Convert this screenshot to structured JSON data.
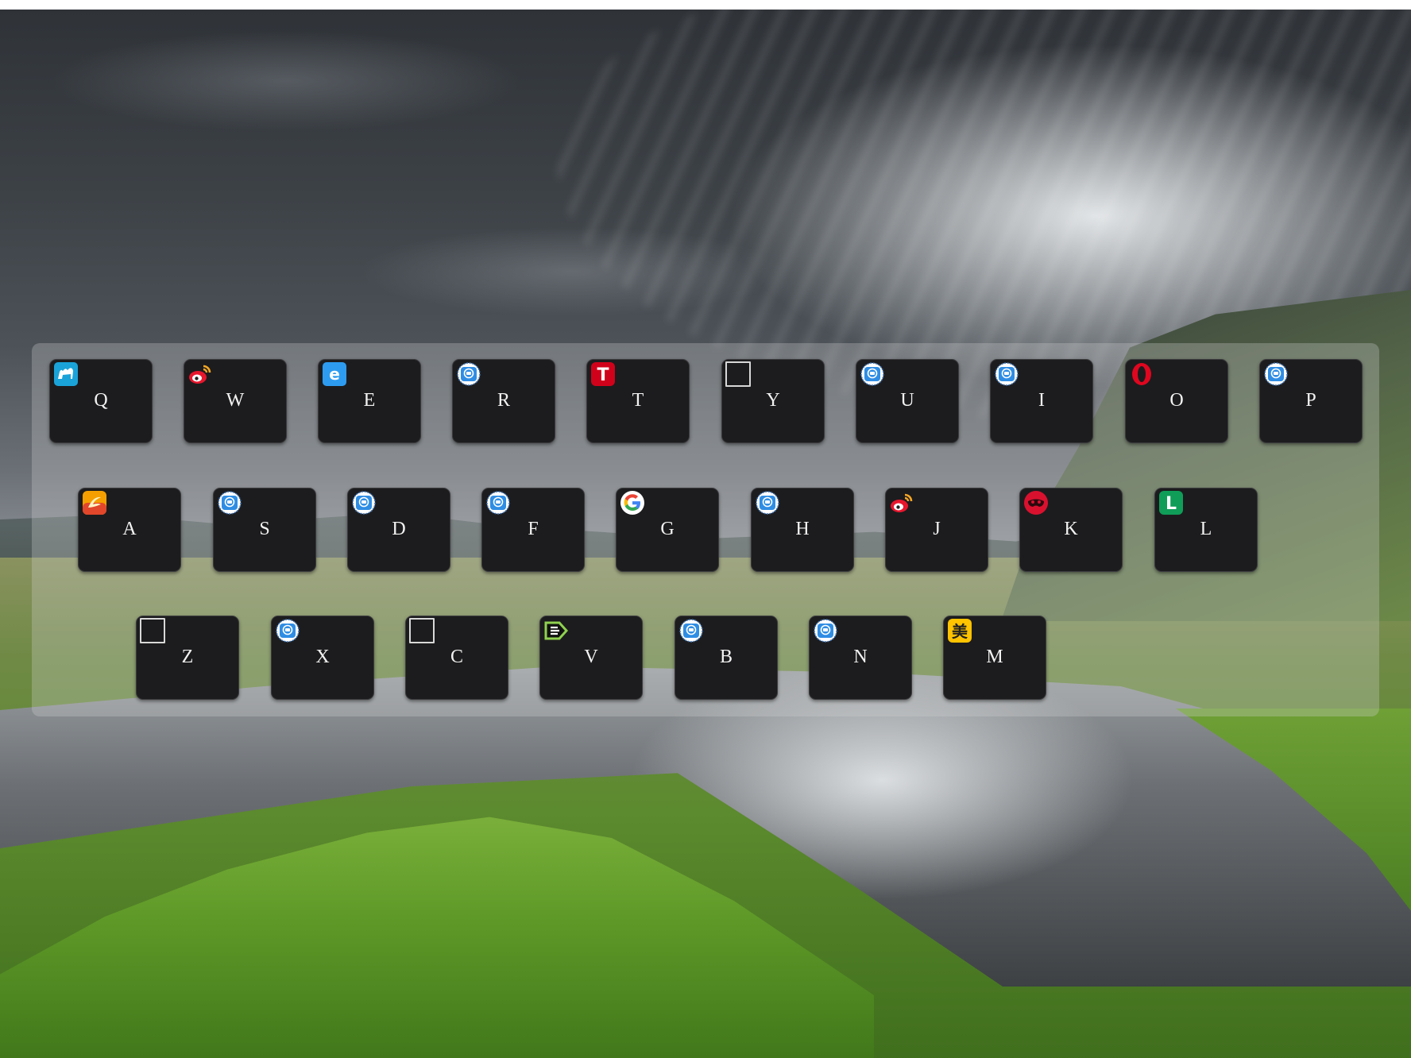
{
  "background": {
    "description_colors": {
      "sky": "#3d4247",
      "meadow": "#5c8a2e",
      "water": "#9ea3a6"
    }
  },
  "panel": {
    "background": "rgba(210,210,210,0.30)",
    "key_color": "#1c1c1e",
    "letter_color": "#f2f2f2"
  },
  "rows": [
    [
      {
        "letter": "Q",
        "icon": "camel-icon"
      },
      {
        "letter": "W",
        "icon": "weibo-icon"
      },
      {
        "letter": "E",
        "icon": "e-browser-icon"
      },
      {
        "letter": "R",
        "icon": "blue-badge-icon"
      },
      {
        "letter": "T",
        "icon": "red-t-icon"
      },
      {
        "letter": "Y",
        "icon": "blank-icon"
      },
      {
        "letter": "U",
        "icon": "blue-badge-icon"
      },
      {
        "letter": "I",
        "icon": "blue-badge-icon"
      },
      {
        "letter": "O",
        "icon": "opera-icon"
      },
      {
        "letter": "P",
        "icon": "blue-badge-icon"
      }
    ],
    [
      {
        "letter": "A",
        "icon": "orange-swirl-icon"
      },
      {
        "letter": "S",
        "icon": "blue-badge-icon"
      },
      {
        "letter": "D",
        "icon": "blue-badge-icon"
      },
      {
        "letter": "F",
        "icon": "blue-badge-icon"
      },
      {
        "letter": "G",
        "icon": "google-icon"
      },
      {
        "letter": "H",
        "icon": "blue-badge-icon"
      },
      {
        "letter": "J",
        "icon": "weibo-icon"
      },
      {
        "letter": "K",
        "icon": "red-mask-icon"
      },
      {
        "letter": "L",
        "icon": "green-l-icon"
      }
    ],
    [
      {
        "letter": "Z",
        "icon": "blank-icon"
      },
      {
        "letter": "X",
        "icon": "blue-badge-icon"
      },
      {
        "letter": "C",
        "icon": "blank-icon"
      },
      {
        "letter": "V",
        "icon": "green-tag-icon"
      },
      {
        "letter": "B",
        "icon": "blue-badge-icon"
      },
      {
        "letter": "N",
        "icon": "blue-badge-icon"
      },
      {
        "letter": "M",
        "icon": "meituan-icon"
      }
    ]
  ],
  "icon_glyphs": {
    "red-t": "T",
    "green-l": "L",
    "meituan": "美",
    "e-browser": "e"
  }
}
